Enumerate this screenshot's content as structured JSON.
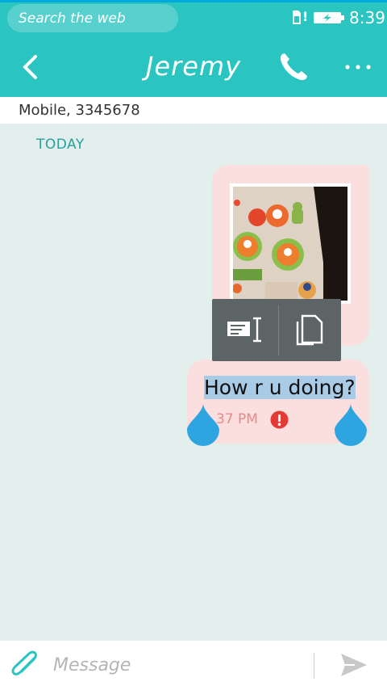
{
  "status_bar": {
    "search_placeholder": "Search the web",
    "signal_alert": "!",
    "time": "8:39"
  },
  "header": {
    "title": "Jeremy"
  },
  "contact": {
    "line": "Mobile, 3345678"
  },
  "thread": {
    "day_label": "TODAY",
    "messages": [
      {
        "type": "image",
        "alt": "Firefox OS stickers photo"
      },
      {
        "type": "text",
        "text": "How r u doing?",
        "time": "37 PM",
        "status": "error"
      }
    ]
  },
  "composer": {
    "placeholder": "Message"
  },
  "colors": {
    "accent": "#2ac4c1",
    "bubble": "#fbdfdf",
    "selection": "#a9cbe6",
    "handle": "#2ea5e0",
    "error": "#e53935"
  },
  "icons": [
    "back-icon",
    "phone-icon",
    "more-icon",
    "select-all-icon",
    "copy-icon",
    "error-icon",
    "paperclip-icon",
    "send-icon"
  ]
}
